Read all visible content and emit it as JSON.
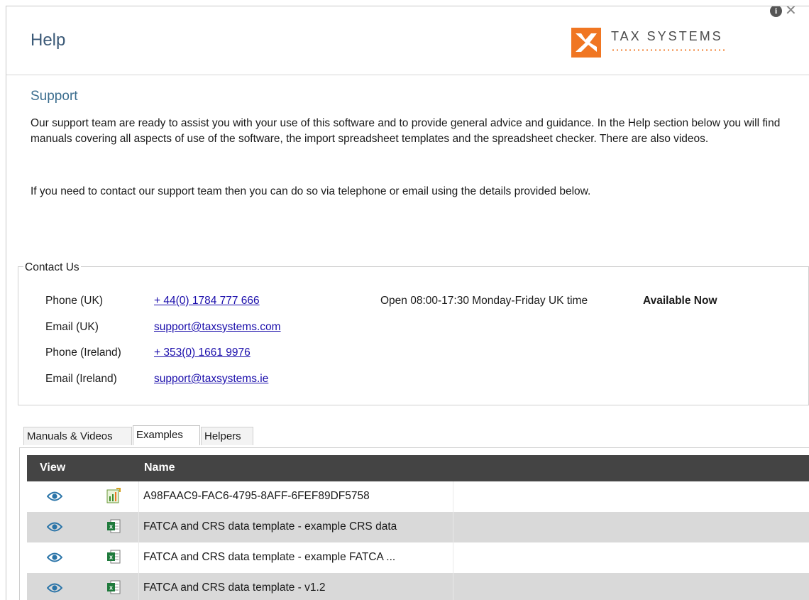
{
  "window": {
    "title": "Help"
  },
  "logo": {
    "text": "TAX SYSTEMS"
  },
  "top_icons": {
    "info": "i",
    "close": "✕"
  },
  "support": {
    "heading": "Support",
    "paragraph": "Our support team are ready to assist you with your use of this software and to provide general advice and guidance.  In the Help section below you will find manuals covering all aspects of use of the software, the import spreadsheet templates and the spreadsheet checker.  There are also videos.",
    "contact_note": "If you need to contact our support team then you can do so via telephone or email using the details provided below."
  },
  "contact": {
    "legend": "Contact Us",
    "rows": [
      {
        "label": "Phone (UK)",
        "value": "+ 44(0) 1784 777 666"
      },
      {
        "label": "Email (UK)",
        "value": "support@taxsystems.com"
      },
      {
        "label": "Phone (Ireland)",
        "value": "+ 353(0) 1661 9976"
      },
      {
        "label": "Email (Ireland)",
        "value": "support@taxsystems.ie"
      }
    ],
    "hours": "Open 08:00-17:30 Monday-Friday UK time",
    "availability": "Available Now"
  },
  "tabs": [
    {
      "label": "Manuals & Videos",
      "active": false
    },
    {
      "label": "Examples",
      "active": true
    },
    {
      "label": "Helpers",
      "active": false
    }
  ],
  "grid": {
    "columns": [
      "View",
      "Name"
    ],
    "rows": [
      {
        "icon": "chart-file-icon",
        "name": "A98FAAC9-FAC6-4795-8AFF-6FEF89DF5758"
      },
      {
        "icon": "excel-file-icon",
        "name": "FATCA and CRS data template - example CRS data"
      },
      {
        "icon": "excel-file-icon",
        "name": "FATCA and CRS data template - example FATCA ..."
      },
      {
        "icon": "excel-file-icon",
        "name": "FATCA and CRS data template - v1.2"
      }
    ]
  },
  "colors": {
    "accent": "#3c6e8f",
    "brand": "#f07622",
    "header": "#444444",
    "link": "#1a0dab"
  }
}
